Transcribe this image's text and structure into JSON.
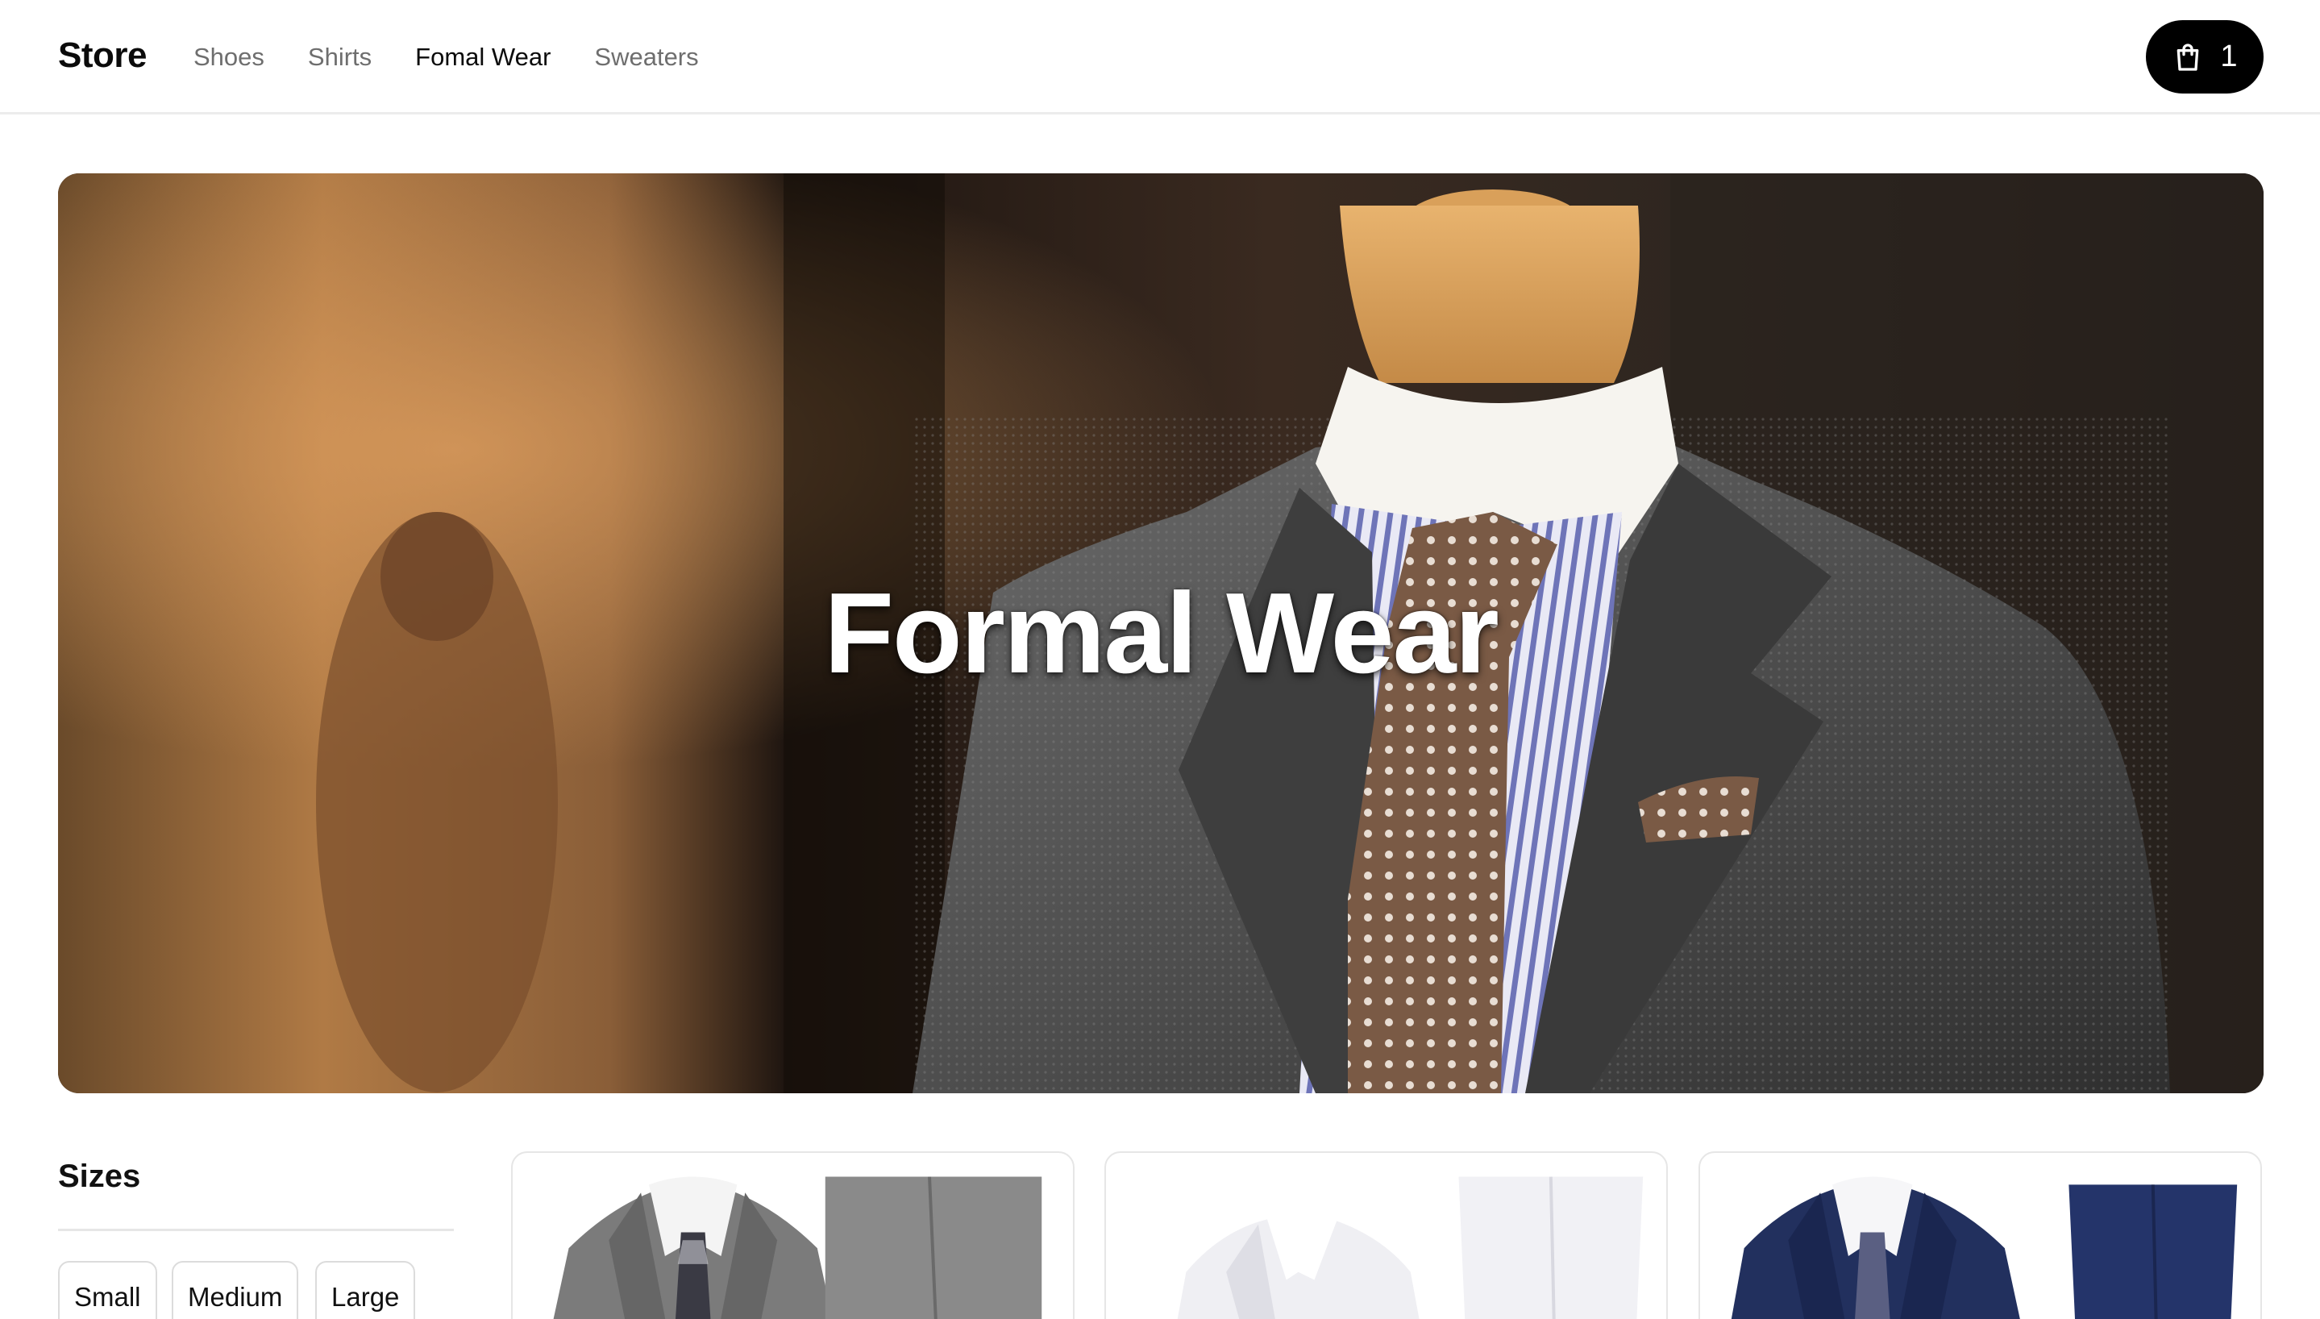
{
  "header": {
    "brand": "Store",
    "nav": [
      {
        "label": "Shoes",
        "active": false
      },
      {
        "label": "Shirts",
        "active": false
      },
      {
        "label": "Fomal Wear",
        "active": true
      },
      {
        "label": "Sweaters",
        "active": false
      }
    ],
    "cart": {
      "icon": "shopping-bag-icon",
      "count": "1"
    }
  },
  "hero": {
    "title": "Formal Wear",
    "image": "suit-on-mannequin-photo"
  },
  "filters": {
    "heading": "Sizes",
    "sizes": [
      "Small",
      "Medium",
      "Large"
    ]
  },
  "products": [
    {
      "image": "gray-suit-photo",
      "color": "#7a7a7a"
    },
    {
      "image": "white-suit-photo",
      "color": "#ececf0"
    },
    {
      "image": "navy-suit-photo",
      "color": "#1f2d5a"
    }
  ],
  "colors": {
    "accent": "#000000",
    "nav_inactive": "#6e6e6e",
    "nav_active": "#0b0b0b",
    "border": "#e6e6e6"
  }
}
